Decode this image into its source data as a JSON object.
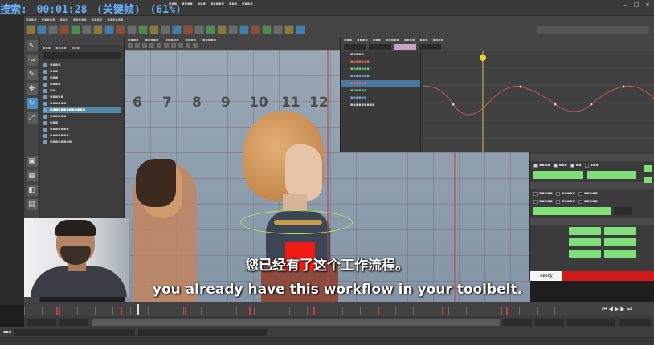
{
  "overlay": {
    "label": "搜索:",
    "time": "00:01:28",
    "mode": "(关键帧)",
    "percent": "(61%)"
  },
  "subtitles": {
    "chinese": "您已经有了这个工作流程。",
    "english": "you already have this workflow in your toolbelt."
  },
  "colors": {
    "overlay_text": "#6ab2ff",
    "ik_button": "#7fe07a",
    "solve_red": "#cf1a1a",
    "selection_blue": "#5285a6",
    "recording_box": "#ef1b12"
  },
  "viewport": {
    "ruler_numbers": [
      "6",
      "7",
      "8",
      "9",
      "10",
      "11",
      "12"
    ]
  },
  "ik_panel": {
    "ready_label": "Ready"
  }
}
